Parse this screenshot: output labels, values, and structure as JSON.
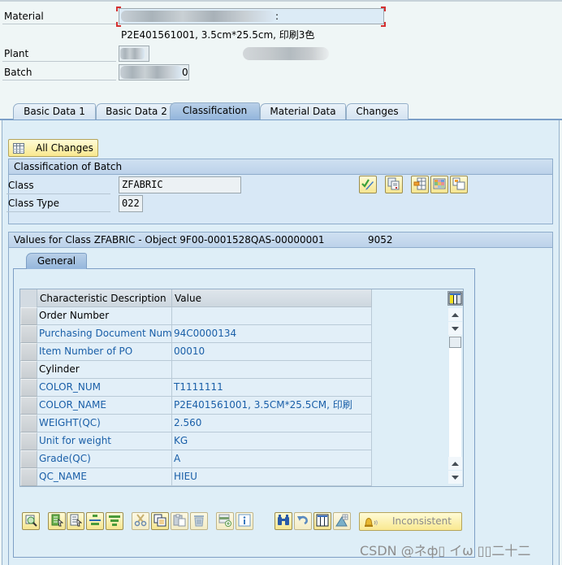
{
  "header": {
    "material_label": "Material",
    "material_value": "",
    "material_description": "P2E401561001, 3.5cm*25.5cm, 印刷3色",
    "plant_label": "Plant",
    "plant_value": "",
    "batch_label": "Batch",
    "batch_value_suffix": "0"
  },
  "tabs": [
    {
      "label": "Basic Data 1",
      "active": false
    },
    {
      "label": "Basic Data 2",
      "active": false
    },
    {
      "label": "Classification",
      "active": true
    },
    {
      "label": "Material Data",
      "active": false
    },
    {
      "label": "Changes",
      "active": false
    }
  ],
  "all_changes_button": {
    "label": "All Changes",
    "icon": "table-icon"
  },
  "classification_frame": {
    "title": "Classification of Batch",
    "class_label": "Class",
    "class_value": "ZFABRIC",
    "class_type_label": "Class Type",
    "class_type_value": "022",
    "toolbar_icons": [
      "check-edit-icon",
      "display-doc-icon",
      "insert-column-icon",
      "color-grid-icon",
      "copy-object-icon"
    ]
  },
  "values_frame": {
    "title": "Values for Class ZFABRIC - Object 9F00-0001528QAS-00000001",
    "title_number": "9052",
    "subtab": "General",
    "columns": [
      "Characteristic Description",
      "Value"
    ],
    "rows": [
      {
        "description": "Order Number",
        "value": "",
        "color": "black"
      },
      {
        "description": "Purchasing Document Num…",
        "value": "94C0000134",
        "color": "blue"
      },
      {
        "description": "Item Number of PO",
        "value": "00010",
        "color": "blue"
      },
      {
        "description": "Cylinder",
        "value": "",
        "color": "black"
      },
      {
        "description": "COLOR_NUM",
        "value": "T1111111",
        "color": "blue"
      },
      {
        "description": "COLOR_NAME",
        "value": "P2E401561001, 3.5CM*25.5CM, 印刷",
        "color": "blue"
      },
      {
        "description": "WEIGHT(QC)",
        "value": "2.560",
        "color": "blue"
      },
      {
        "description": "Unit for weight",
        "value": "KG",
        "color": "blue"
      },
      {
        "description": "Grade(QC)",
        "value": "A",
        "color": "blue"
      },
      {
        "description": "QC_NAME",
        "value": "HIEU",
        "color": "blue"
      }
    ]
  },
  "bottom_toolbar": {
    "icons": [
      "detail-search-icon",
      "select-all-icon",
      "deselect-all-icon",
      "align-icon",
      "filter-icon",
      "cut-icon",
      "copy-icon",
      "paste-icon",
      "delete-icon",
      "insert-row-icon",
      "info-icon",
      "find-icon",
      "undo-icon",
      "columns-icon",
      "triangle-grid-icon"
    ],
    "inconsistent_label": "Inconsistent"
  },
  "watermark": "CSDN @ネф▯ イω ▯▯二十二",
  "colors": {
    "background": "#eff6f6",
    "panel": "#deeef7",
    "frame_title": "#c3d7ec",
    "button_yellow": "#f9e88f",
    "text_blue": "#1a5fa8"
  }
}
